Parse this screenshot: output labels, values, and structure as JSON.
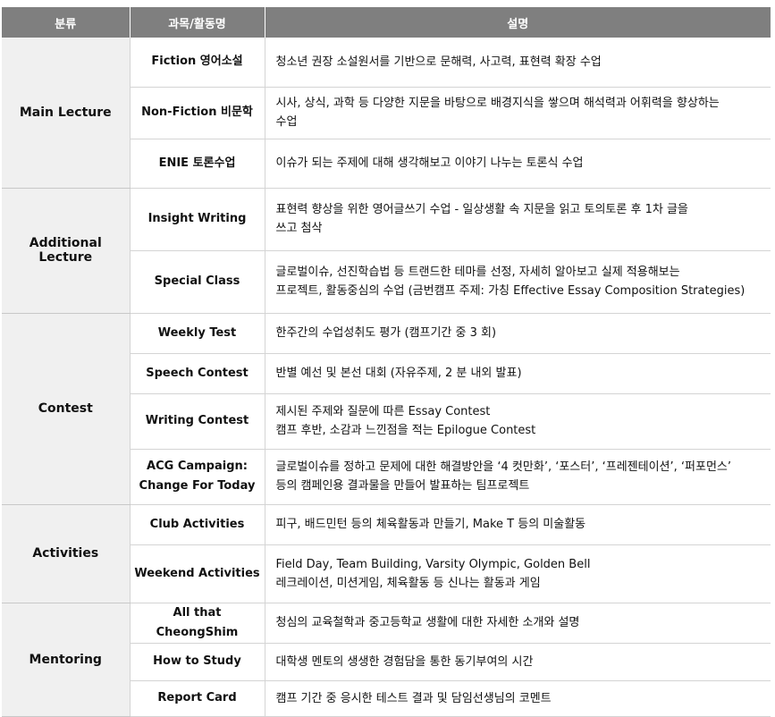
{
  "header": {
    "col1": "분류",
    "col2": "과목/활동명",
    "col3": "설명"
  },
  "groups": [
    {
      "category": "Main Lecture",
      "rows": [
        {
          "course": "Fiction 영어소설",
          "desc": [
            "청소년 권장 소설원서를 기반으로 문해력, 사고력, 표현력 확장 수업"
          ]
        },
        {
          "course": "Non-Fiction 비문학",
          "desc": [
            "시사, 상식, 과학 등 다양한 지문을 바탕으로 배경지식을 쌓으며 해석력과 어휘력을 향상하는",
            "수업"
          ]
        },
        {
          "course": "ENIE 토론수업",
          "desc": [
            "이슈가 되는 주제에 대해 생각해보고 이야기 나누는 토론식 수업"
          ]
        }
      ]
    },
    {
      "category": "Additional Lecture",
      "rows": [
        {
          "course": "Insight Writing",
          "desc": [
            "표현력 향상을 위한 영어글쓰기 수업 - 일상생활 속 지문을 읽고 토의토론 후 1차 글을",
            "쓰고 첨삭"
          ]
        },
        {
          "course": "Special Class",
          "desc": [
            "글로벌이슈, 선진학습법 등 트랜드한 테마를 선정, 자세히 알아보고 실제 적용해보는",
            "프로젝트, 활동중심의 수업 (금번캠프 주제: 가칭 Effective Essay Composition Strategies)"
          ]
        }
      ]
    },
    {
      "category": "Contest",
      "rows": [
        {
          "course": "Weekly Test",
          "desc": [
            "한주간의 수업성취도 평가 (캠프기간 중 3 회)"
          ]
        },
        {
          "course": "Speech Contest",
          "desc": [
            "반별 예선 및 본선 대회 (자유주제, 2 분 내외 발표)"
          ]
        },
        {
          "course": "Writing Contest",
          "desc": [
            "제시된 주제와 질문에 따른 Essay Contest",
            "캠프 후반, 소감과 느낀점을 적는 Epilogue Contest"
          ]
        },
        {
          "course": "ACG Campaign: Change For Today",
          "course_lines": [
            "ACG Campaign:",
            "Change For Today"
          ],
          "desc": [
            "글로벌이슈를 정하고 문제에 대한 해결방안을 ‘4 컷만화’, ‘포스터’, ‘프레젠테이션’, ‘퍼포먼스’",
            "등의 캠페인용 결과물을 만들어 발표하는 팀프로젝트"
          ]
        }
      ]
    },
    {
      "category": "Activities",
      "rows": [
        {
          "course": "Club Activities",
          "desc": [
            "피구, 배드민턴 등의 체육활동과 만들기, Make T 등의 미술활동"
          ]
        },
        {
          "course": "Weekend Activities",
          "desc": [
            "Field Day, Team Building, Varsity Olympic, Golden Bell",
            "레크레이션, 미션게임, 체육활동 등 신나는 활동과 게임"
          ]
        }
      ]
    },
    {
      "category": "Mentoring",
      "rows": [
        {
          "course": "All that CheongShim",
          "desc": [
            "청심의 교육철학과 중고등학교 생활에 대한 자세한 소개와 설명"
          ]
        },
        {
          "course": "How to Study",
          "desc": [
            "대학생 멘토의 생생한 경험담을 통한 동기부여의 시간"
          ]
        },
        {
          "course": "Report Card",
          "desc": [
            "캠프 기간 중 응시한 테스트 결과 및 담임선생님의 코멘트"
          ]
        }
      ]
    }
  ]
}
